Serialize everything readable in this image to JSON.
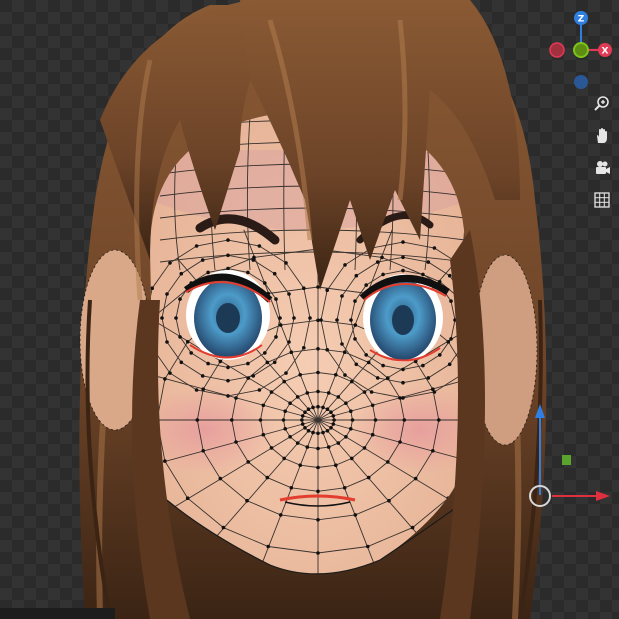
{
  "viewport": {
    "mode": "edit-mesh",
    "subject": "anime-character-head"
  },
  "navigation_gizmo": {
    "axes": [
      {
        "id": "pos-z",
        "label": "Z",
        "color": "#2f7fe0"
      },
      {
        "id": "pos-x",
        "label": "X",
        "color": "#e23a55"
      },
      {
        "id": "pos-y",
        "label": "",
        "color": "#7fc31a"
      },
      {
        "id": "neg-x",
        "label": "",
        "color": "#a3303f"
      },
      {
        "id": "neg-z",
        "label": "",
        "color": "#2a5896"
      }
    ]
  },
  "nav_tools": [
    {
      "id": "zoom",
      "icon": "zoom-icon"
    },
    {
      "id": "pan",
      "icon": "hand-pan-icon"
    },
    {
      "id": "camera",
      "icon": "camera-icon"
    },
    {
      "id": "ortho",
      "icon": "grid-ortho-icon"
    }
  ],
  "transform_gizmo": {
    "colors": {
      "x": "#e0303f",
      "z": "#2f80e6",
      "y_plane": "#5aa32c",
      "pivot": "#d9d9d9"
    }
  },
  "colors": {
    "skin": "#efc3a7",
    "blush": "#e79a9d",
    "hair": "#6d4428",
    "hair_highlight": "#a06e44",
    "wire": "#1a1a1a",
    "selected_edge": "#e33d2f",
    "iris": "#4d9bc9"
  }
}
